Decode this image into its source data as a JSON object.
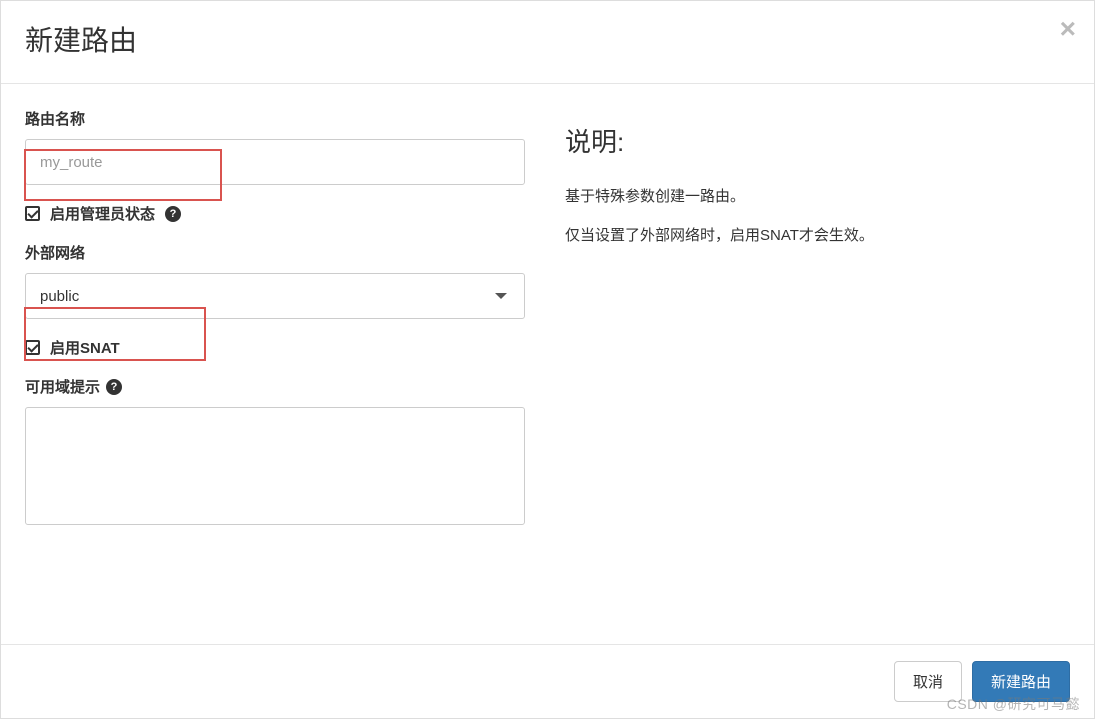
{
  "modal": {
    "title": "新建路由",
    "close_symbol": "×"
  },
  "form": {
    "name_label": "路由名称",
    "name_placeholder": "my_route",
    "admin_state_label": "启用管理员状态",
    "external_network_label": "外部网络",
    "external_network_value": "public",
    "enable_snat_label": "启用SNAT",
    "availability_hint_label": "可用域提示",
    "help_symbol": "?"
  },
  "description": {
    "title": "说明:",
    "line1": "基于特殊参数创建一路由。",
    "line2": "仅当设置了外部网络时，启用SNAT才会生效。"
  },
  "footer": {
    "cancel": "取消",
    "submit": "新建路由"
  },
  "watermark": "CSDN @研究可马懿"
}
